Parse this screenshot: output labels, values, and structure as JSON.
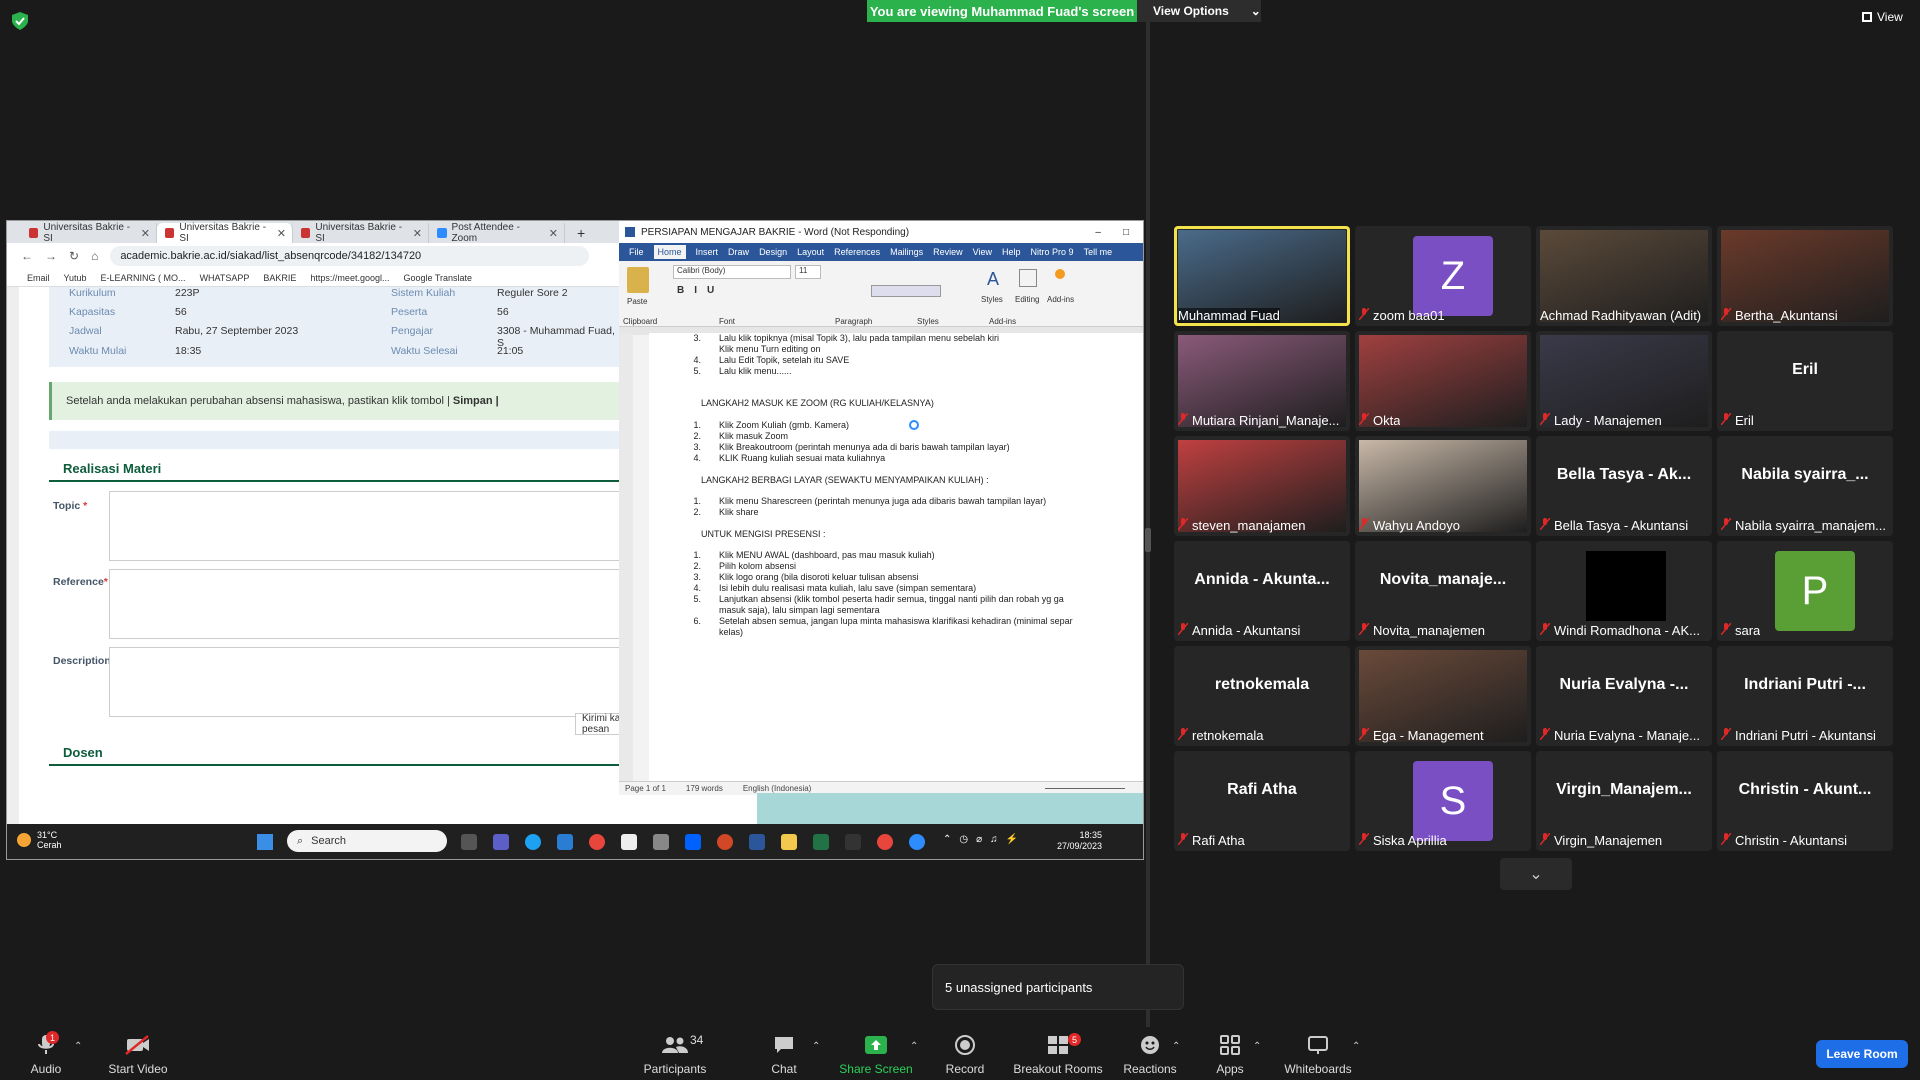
{
  "top": {
    "banner": "You are viewing Muhammad Fuad's screen",
    "view_options": "View Options",
    "view": "View"
  },
  "browser": {
    "tabs": [
      "Universitas Bakrie - SI",
      "Universitas Bakrie - SI",
      "Universitas Bakrie - SI",
      "Post Attendee - Zoom"
    ],
    "url": "academic.bakrie.ac.id/siakad/list_absenqrcode/34182/134720",
    "bookmarks": [
      "Email",
      "Yutub",
      "E-LEARNING ( MO...",
      "WHATSAPP",
      "BAKRIE",
      "https://meet.googl...",
      "Google Translate"
    ]
  },
  "siakad": {
    "rows": [
      {
        "l1": "Kurikulum",
        "v1": "223P",
        "l2": "Sistem Kuliah",
        "v2": "Reguler Sore 2"
      },
      {
        "l1": "Kapasitas",
        "v1": "56",
        "l2": "Peserta",
        "v2": "56"
      },
      {
        "l1": "Jadwal",
        "v1": "Rabu, 27 September 2023",
        "l2": "Pengajar",
        "v2": "3308 - Muhammad Fuad, S"
      },
      {
        "l1": "Waktu Mulai",
        "v1": "18:35",
        "l2": "Waktu Selesai",
        "v2": "21:05"
      }
    ],
    "alert": "Setelah anda melakukan perubahan absensi mahasiswa, pastikan klik tombol |",
    "alert_btn": "Simpan |",
    "realisasi": "Realisasi Materi",
    "topic": "Topic",
    "reference": "Reference",
    "description": "Description",
    "dosen": "Dosen",
    "kirim": "Kirimi kami pesan"
  },
  "word": {
    "title": "PERSIAPAN MENGAJAR BAKRIE - Word (Not Responding)",
    "menu": [
      "File",
      "Home",
      "Insert",
      "Draw",
      "Design",
      "Layout",
      "References",
      "Mailings",
      "Review",
      "View",
      "Help",
      "Nitro Pro 9",
      "Tell me"
    ],
    "font": "Calibri (Body)",
    "size": "11",
    "groups": [
      "Clipboard",
      "Font",
      "Paragraph",
      "Styles",
      "Add-ins"
    ],
    "paste": "Paste",
    "styles": "Styles",
    "editing": "Editing",
    "addins": "Add-ins",
    "status": {
      "page": "Page 1 of 1",
      "words": "179 words",
      "lang": "English (Indonesia)"
    },
    "doc": [
      {
        "n": "3.",
        "t": "Lalu klik topiknya (misal Topik 3), lalu pada tampilan menu sebelah kiri"
      },
      {
        "n": "",
        "t": "Klik menu Turn editing on"
      },
      {
        "n": "4.",
        "t": "Lalu Edit Topik, setelah itu  SAVE"
      },
      {
        "n": "5.",
        "t": "Lalu klik menu......"
      }
    ],
    "h1": "LANGKAH2 MASUK KE ZOOM (RG KULIAH/KELASNYA)",
    "s1": [
      {
        "n": "1.",
        "t": "Klik Zoom Kuliah (gmb. Kamera)"
      },
      {
        "n": "2.",
        "t": "Klik masuk Zoom"
      },
      {
        "n": "3.",
        "t": "Klik Breakoutroom (perintah menunya ada di baris bawah tampilan layar)"
      },
      {
        "n": "4.",
        "t": "KLIK Ruang kuliah sesuai mata kuliahnya"
      }
    ],
    "h2": "LANGKAH2 BERBAGI LAYAR (SEWAKTU MENYAMPAIKAN KULIAH) :",
    "s2": [
      {
        "n": "1.",
        "t": "Klik menu Sharescreen (perintah menunya juga ada dibaris bawah tampilan layar)"
      },
      {
        "n": "2.",
        "t": "Klik share"
      }
    ],
    "h3": "UNTUK MENGISI PRESENSI :",
    "s3": [
      {
        "n": "1.",
        "t": "Klik MENU AWAL (dashboard, pas mau masuk kuliah)"
      },
      {
        "n": "2.",
        "t": "Pilih kolom absensi"
      },
      {
        "n": "3.",
        "t": "Klik logo orang (bila disoroti keluar tulisan absensi"
      },
      {
        "n": "4.",
        "t": "Isi lebih dulu realisasi mata kuliah, lalu save (simpan sementara)"
      },
      {
        "n": "5.",
        "t": "Lanjutkan absensi (klik tombol peserta hadir semua, tinggal nanti pilih dan robah yg ga"
      },
      {
        "n": "",
        "t": "masuk saja), lalu simpan lagi sementara"
      },
      {
        "n": "6.",
        "t": "Setelah absen semua, jangan lupa minta mahasiswa klarifikasi kehadiran (minimal separ"
      },
      {
        "n": "",
        "t": "kelas)"
      }
    ]
  },
  "taskbar": {
    "temp": "31°C",
    "weather": "Cerah",
    "search": "Search",
    "time": "18:35",
    "date": "27/09/2023"
  },
  "participants": [
    {
      "name": "Muhammad Fuad",
      "kind": "video",
      "muted": false
    },
    {
      "name": "zoom baa01",
      "kind": "avatar",
      "initial": "Z",
      "color": "#7b4fc4",
      "muted": true
    },
    {
      "name": "Achmad Radhityawan (Adit)",
      "kind": "video",
      "muted": false
    },
    {
      "name": "Bertha_Akuntansi",
      "kind": "video",
      "muted": true
    },
    {
      "name": "Mutiara Rinjani_Manaje...",
      "kind": "video",
      "muted": true
    },
    {
      "name": "Okta",
      "kind": "video",
      "muted": true
    },
    {
      "name": "Lady - Manajemen",
      "kind": "video",
      "muted": true
    },
    {
      "name": "Eril",
      "kind": "text",
      "big": "Eril",
      "muted": true
    },
    {
      "name": "steven_manajamen",
      "kind": "video",
      "muted": true
    },
    {
      "name": "Wahyu Andoyo",
      "kind": "video",
      "muted": true
    },
    {
      "name": "Bella Tasya - Akuntansi",
      "kind": "text",
      "big": "Bella Tasya - Ak...",
      "muted": true
    },
    {
      "name": "Nabila syairra_manajem...",
      "kind": "text",
      "big": "Nabila  syairra_...",
      "muted": true
    },
    {
      "name": "Annida - Akuntansi",
      "kind": "text",
      "big": "Annida  - Akunta...",
      "muted": true
    },
    {
      "name": "Novita_manajemen",
      "kind": "text",
      "big": "Novita_manaje...",
      "muted": true
    },
    {
      "name": "Windi Romadhona - AK...",
      "kind": "black",
      "muted": true
    },
    {
      "name": "sara",
      "kind": "avatar",
      "initial": "P",
      "color": "#5a9e36",
      "muted": true
    },
    {
      "name": "retnokemala",
      "kind": "text",
      "big": "retnokemala",
      "muted": true
    },
    {
      "name": "Ega - Management",
      "kind": "video",
      "muted": true
    },
    {
      "name": "Nuria Evalyna - Manaje...",
      "kind": "text",
      "big": "Nuria  Evalyna  -...",
      "muted": true
    },
    {
      "name": "Indriani Putri - Akuntansi",
      "kind": "text",
      "big": "Indriani  Putri  -...",
      "muted": true
    },
    {
      "name": "Rafi Atha",
      "kind": "text",
      "big": "Rafi Atha",
      "muted": true
    },
    {
      "name": "Siska Aprillia",
      "kind": "avatar",
      "initial": "S",
      "color": "#7b4fc4",
      "muted": true
    },
    {
      "name": "Virgin_Manajemen",
      "kind": "text",
      "big": "Virgin_Manajem...",
      "muted": true
    },
    {
      "name": "Christin  - Akuntansi",
      "kind": "text",
      "big": "Christin  - Akunt...",
      "muted": true
    }
  ],
  "unassigned": "5 unassigned participants",
  "toolbar": {
    "audio": "Audio",
    "video": "Start Video",
    "participants": "Participants",
    "participants_count": "34",
    "chat": "Chat",
    "share": "Share Screen",
    "record": "Record",
    "breakout": "Breakout Rooms",
    "breakout_count": "5",
    "reactions": "Reactions",
    "apps": "Apps",
    "whiteboards": "Whiteboards",
    "leave": "Leave Room",
    "audio_badge": "1"
  },
  "colors": {
    "share_green": "#2bb24c",
    "leave_blue": "#1e6ee8",
    "active_speaker": "#f2e34d",
    "word_blue": "#2b579a"
  }
}
